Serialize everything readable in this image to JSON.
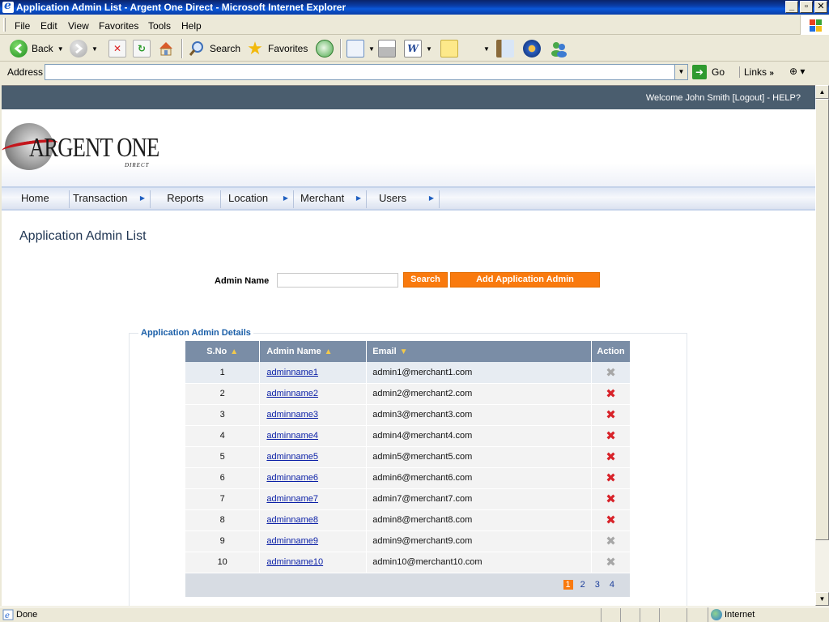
{
  "window": {
    "title": "Application Admin List - Argent One Direct - Microsoft Internet Explorer",
    "controls": {
      "minimize": "_",
      "maximize": "▫",
      "close": "✕"
    }
  },
  "menubar": [
    "File",
    "Edit",
    "View",
    "Favorites",
    "Tools",
    "Help"
  ],
  "toolbar": {
    "back": "Back",
    "search": "Search",
    "favorites": "Favorites"
  },
  "addressbar": {
    "label": "Address",
    "value": "",
    "go": "Go",
    "links": "Links"
  },
  "page": {
    "welcome": "Welcome John Smith   [Logout]  -  HELP?",
    "logo": {
      "brand": "ARGENT ONE",
      "sub": "DIRECT"
    },
    "nav": [
      {
        "label": "Home",
        "has_submenu": false
      },
      {
        "label": "Transaction",
        "has_submenu": true
      },
      {
        "label": "Reports",
        "has_submenu": false
      },
      {
        "label": "Location",
        "has_submenu": true
      },
      {
        "label": "Merchant",
        "has_submenu": true
      },
      {
        "label": "Users",
        "has_submenu": true
      }
    ],
    "title": "Application Admin List",
    "search": {
      "label": "Admin Name",
      "value": "",
      "search_button": "Search",
      "add_button": "Add Application Admin"
    },
    "details": {
      "legend": "Application Admin Details",
      "columns": [
        "S.No",
        "Admin Name",
        "Email",
        "Action"
      ],
      "rows": [
        {
          "sno": "1",
          "name": "adminname1",
          "email": "admin1@merchant1.com",
          "deletable": false
        },
        {
          "sno": "2",
          "name": "adminname2",
          "email": "admin2@merchant2.com",
          "deletable": true
        },
        {
          "sno": "3",
          "name": "adminname3",
          "email": "admin3@merchant3.com",
          "deletable": true
        },
        {
          "sno": "4",
          "name": "adminname4",
          "email": "admin4@merchant4.com",
          "deletable": true
        },
        {
          "sno": "5",
          "name": "adminname5",
          "email": "admin5@merchant5.com",
          "deletable": true
        },
        {
          "sno": "6",
          "name": "adminname6",
          "email": "admin6@merchant6.com",
          "deletable": true
        },
        {
          "sno": "7",
          "name": "adminname7",
          "email": "admin7@merchant7.com",
          "deletable": true
        },
        {
          "sno": "8",
          "name": "adminname8",
          "email": "admin8@merchant8.com",
          "deletable": true
        },
        {
          "sno": "9",
          "name": "adminname9",
          "email": "admin9@merchant9.com",
          "deletable": false
        },
        {
          "sno": "10",
          "name": "adminname10",
          "email": "admin10@merchant10.com",
          "deletable": false
        }
      ],
      "pages": [
        "1",
        "2",
        "3",
        "4"
      ],
      "current_page": "1"
    }
  },
  "statusbar": {
    "status": "Done",
    "zone": "Internet"
  },
  "colors": {
    "accent_orange": "#f97a0e",
    "header_strip": "#4a5d6e",
    "grid_header": "#7a8da6",
    "delete_red": "#d8232a",
    "delete_disabled": "#a7a7a7"
  }
}
